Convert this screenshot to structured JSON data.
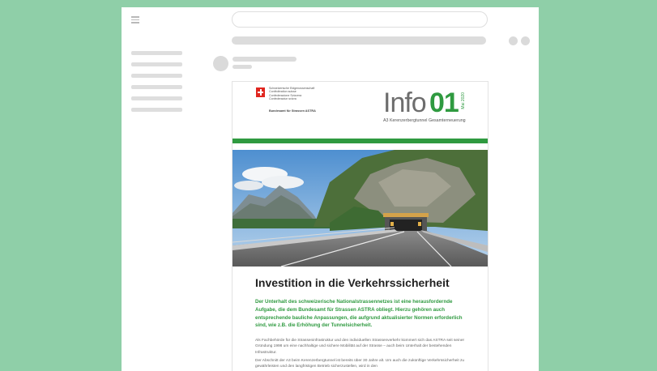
{
  "document": {
    "confederation_lines": [
      "Schweizerische Eidgenossenschaft",
      "Confédération suisse",
      "Confederazione Svizzera",
      "Confederaziun svizra"
    ],
    "office": "Bundesamt für Strassen ASTRA",
    "info_word": "Info",
    "info_number": "01",
    "info_date": "Mai 2020",
    "info_subtitle": "A3 Kerenzerbergtunnel Gesamterneuerung",
    "headline": "Investition in die Verkehrssicherheit",
    "lead": "Der Unterhalt des schweizerische Nationalstrassennetzes ist eine herausfordernde Aufgabe, die dem Bundesamt für Strassen ASTRA obliegt. Hierzu gehören auch entsprechende bauliche Anpassungen, die aufgrund aktualisierter Normen erforderlich sind, wie z.B. die Erhöhung der Tunnelsicherheit.",
    "paragraph_1": "Als Fachbehörde für die Strasseninfrastruktur und den individuellen Strassenverkehr kümmert sich das ASTRA seit seiner Gründung 1998 um eine nachhaltige und sichere Mobilität auf der Strasse – auch beim Unterhalt der bestehenden Infrastruktur.",
    "paragraph_2": "Der Abschnitt der A3 beim Kerenzerbergtunnel ist bereits über 30 Jahre alt. Um auch die zukünftige Verkehrssicherheit zu gewährleisten und den langfristigen Betrieb sicherzustellen, wird in den"
  },
  "colors": {
    "background": "#8fcfa8",
    "accent_green": "#2f9a40",
    "placeholder_gray": "#dcdcdc"
  },
  "icons": [
    "menu-icon",
    "swiss-flag-icon"
  ]
}
